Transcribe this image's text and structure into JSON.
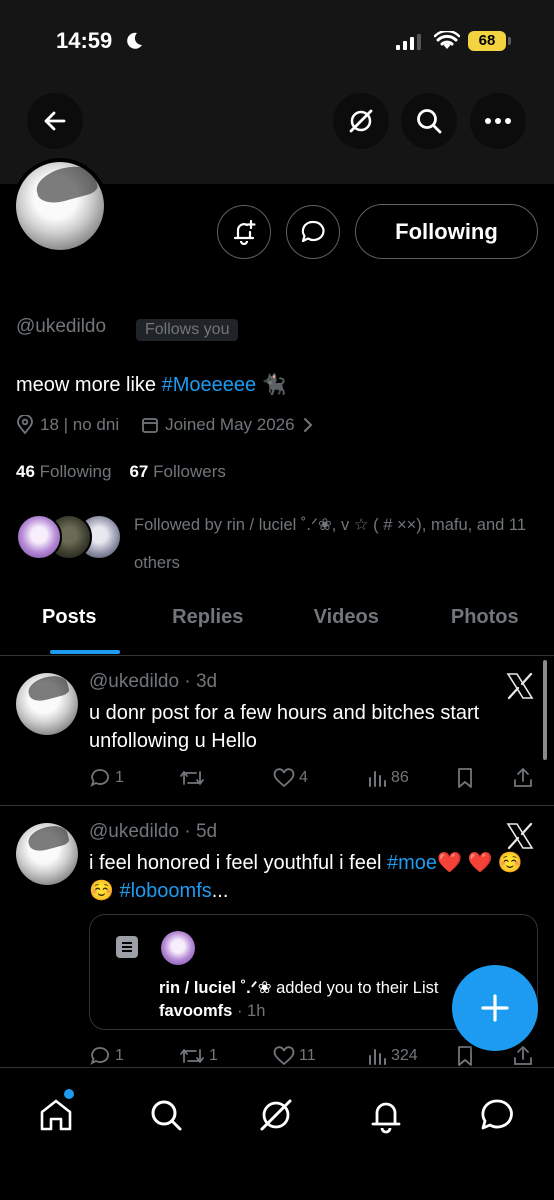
{
  "status_bar": {
    "time": "14:59",
    "battery": "68"
  },
  "profile": {
    "handle": "@ukedildo",
    "follows_you": "Follows you",
    "bio_text": "meow more like ",
    "bio_hashtag": "#Moeeeee",
    "bio_emoji": "🐈‍⬛",
    "location": "18 | no dni",
    "joined": "Joined May 2026",
    "following_count": "46",
    "following_label": "Following",
    "followers_count": "67",
    "followers_label": "Followers",
    "followed_by": "Followed by rin / luciel ˚.ᐟ❀, v ☆ ( # ××), mafu, and 11 others",
    "following_button": "Following"
  },
  "tabs": [
    "Posts",
    "Replies",
    "Videos",
    "Photos"
  ],
  "posts": [
    {
      "handle": "@ukedildo",
      "time": "· 3d",
      "text": "u donr post for a few hours and bitches start unfollowing u Hello",
      "replies": "1",
      "reposts": "",
      "likes": "4",
      "views": "86"
    },
    {
      "handle": "@ukedildo",
      "time": "· 5d",
      "text_before": "i feel honored i feel youthful i feel ",
      "tag1": "#moe",
      "text_mid": "❤️ ❤️ ☺️ ☺️ ",
      "tag2": "#loboomfs",
      "text_end": "...",
      "quote_name": "rin / luciel ˚.ᐟ❀",
      "quote_action": " added you to their List",
      "quote_list": "favoomfs",
      "quote_time": " · 1h",
      "replies": "1",
      "reposts": "1",
      "likes": "11",
      "views": "324"
    }
  ]
}
